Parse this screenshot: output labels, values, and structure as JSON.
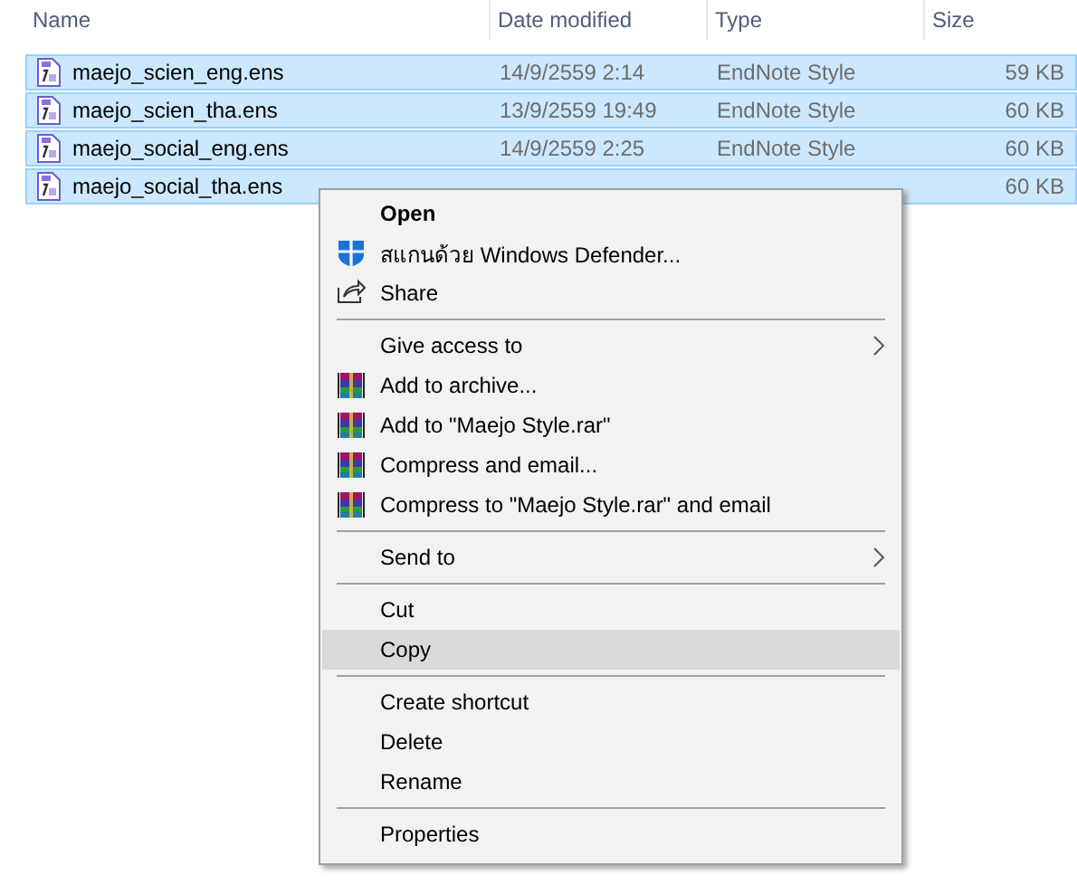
{
  "columns": [
    "Name",
    "Date modified",
    "Type",
    "Size"
  ],
  "files": [
    {
      "name": "maejo_scien_eng.ens",
      "date": "14/9/2559 2:14",
      "type": "EndNote Style",
      "size": "59 KB",
      "selected": true
    },
    {
      "name": "maejo_scien_tha.ens",
      "date": "13/9/2559 19:49",
      "type": "EndNote Style",
      "size": "60 KB",
      "selected": true
    },
    {
      "name": "maejo_social_eng.ens",
      "date": "14/9/2559 2:25",
      "type": "EndNote Style",
      "size": "60 KB",
      "selected": true
    },
    {
      "name": "maejo_social_tha.ens",
      "size": "60 KB",
      "selected": true
    }
  ],
  "context_menu": [
    {
      "kind": "item",
      "label": "Open",
      "bold": true
    },
    {
      "kind": "defender",
      "label": "สแกนด้วย Windows Defender..."
    },
    {
      "kind": "share",
      "label": "Share"
    },
    {
      "kind": "separator"
    },
    {
      "kind": "item",
      "label": "Give access to",
      "submenu": true
    },
    {
      "kind": "archive",
      "label": "Add to archive..."
    },
    {
      "kind": "archive",
      "label": "Add to \"Maejo Style.rar\""
    },
    {
      "kind": "archive",
      "label": "Compress and email..."
    },
    {
      "kind": "archive",
      "label": "Compress to \"Maejo Style.rar\" and email"
    },
    {
      "kind": "separator"
    },
    {
      "kind": "item",
      "label": "Send to",
      "submenu": true
    },
    {
      "kind": "separator"
    },
    {
      "kind": "item",
      "label": "Cut"
    },
    {
      "kind": "item",
      "label": "Copy",
      "highlighted": true
    },
    {
      "kind": "separator"
    },
    {
      "kind": "item",
      "label": "Create shortcut"
    },
    {
      "kind": "item",
      "label": "Delete"
    },
    {
      "kind": "item",
      "label": "Rename"
    },
    {
      "kind": "separator"
    },
    {
      "kind": "item",
      "label": "Properties"
    }
  ]
}
